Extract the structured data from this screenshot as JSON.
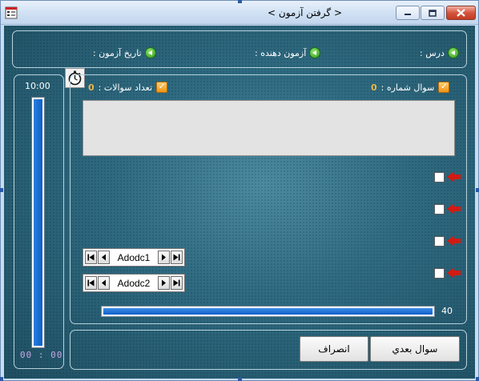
{
  "window": {
    "title": "< گرفتن آزمون >",
    "icon": "form-icon"
  },
  "caption": {
    "minimize_icon": "minimize-icon",
    "maximize_icon": "maximize-icon",
    "close_icon": "close-icon"
  },
  "info": {
    "lesson_label": "درس :",
    "examiner_label": "آزمون دهنده :",
    "date_label": "تاريخ آزمون :"
  },
  "question_header": {
    "question_number_label": "سوال شماره :",
    "question_number_value": "0",
    "question_count_label": "تعداد سوالات :",
    "question_count_value": "0"
  },
  "question": {
    "text": ""
  },
  "options": [
    {
      "checked": false
    },
    {
      "checked": false
    },
    {
      "checked": false
    },
    {
      "checked": false
    }
  ],
  "adodc": [
    {
      "caption": "Adodc1"
    },
    {
      "caption": "Adodc2"
    }
  ],
  "progress": {
    "value": "40",
    "fill_fraction": 1.0
  },
  "timer": {
    "total": "10:00",
    "elapsed": "00 : 00",
    "fill_fraction": 1.0,
    "icon": "stopwatch-icon"
  },
  "buttons": {
    "next": "سوال بعدي",
    "cancel": "انصراف"
  },
  "colors": {
    "background": "#2f6b82",
    "accent_blue": "#0f5ec8",
    "option_arrow": "#d41a12",
    "label_number": "#e8b84a"
  }
}
